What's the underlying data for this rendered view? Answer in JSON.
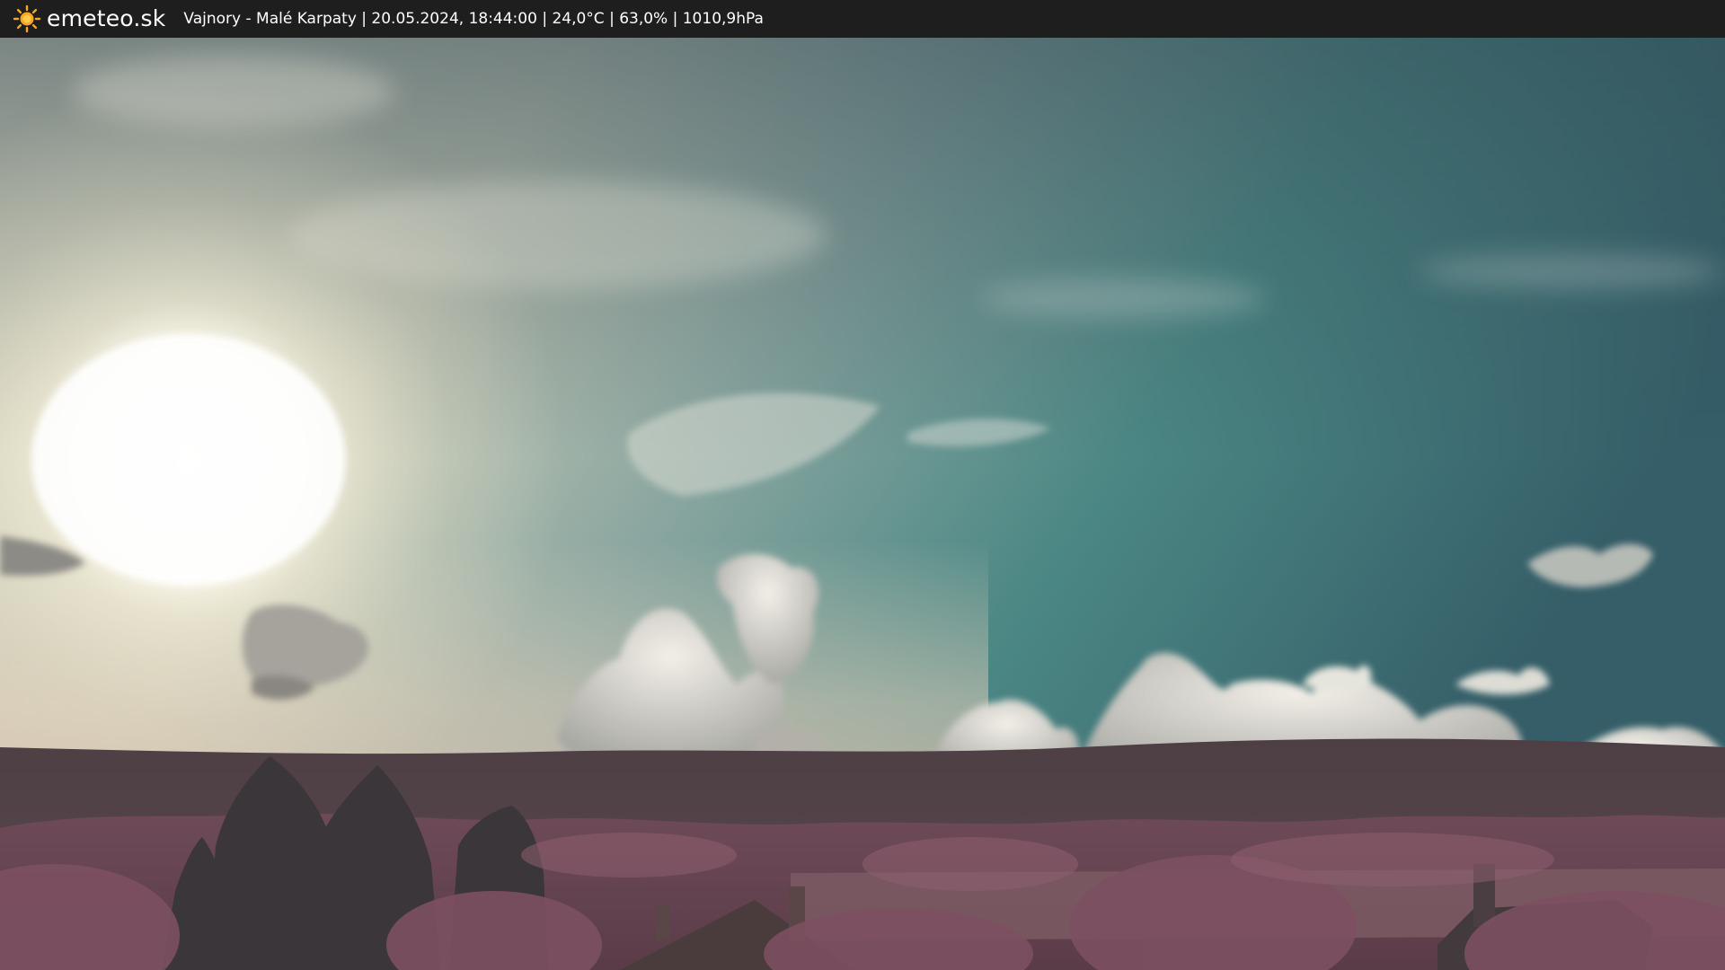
{
  "header": {
    "brand": "emeteo.sk",
    "info": "Vajnory - Malé Karpaty | 20.05.2024, 18:44:00 | 24,0°C | 63,0% | 1010,9hPa",
    "logo_icon": "sun-icon"
  },
  "colors": {
    "topbar": "#1e1e1e",
    "logo_sun": "#f5a623",
    "sky_teal": "#3f8683",
    "sky_dark": "#34555f",
    "foliage": "#7a4f5e"
  }
}
